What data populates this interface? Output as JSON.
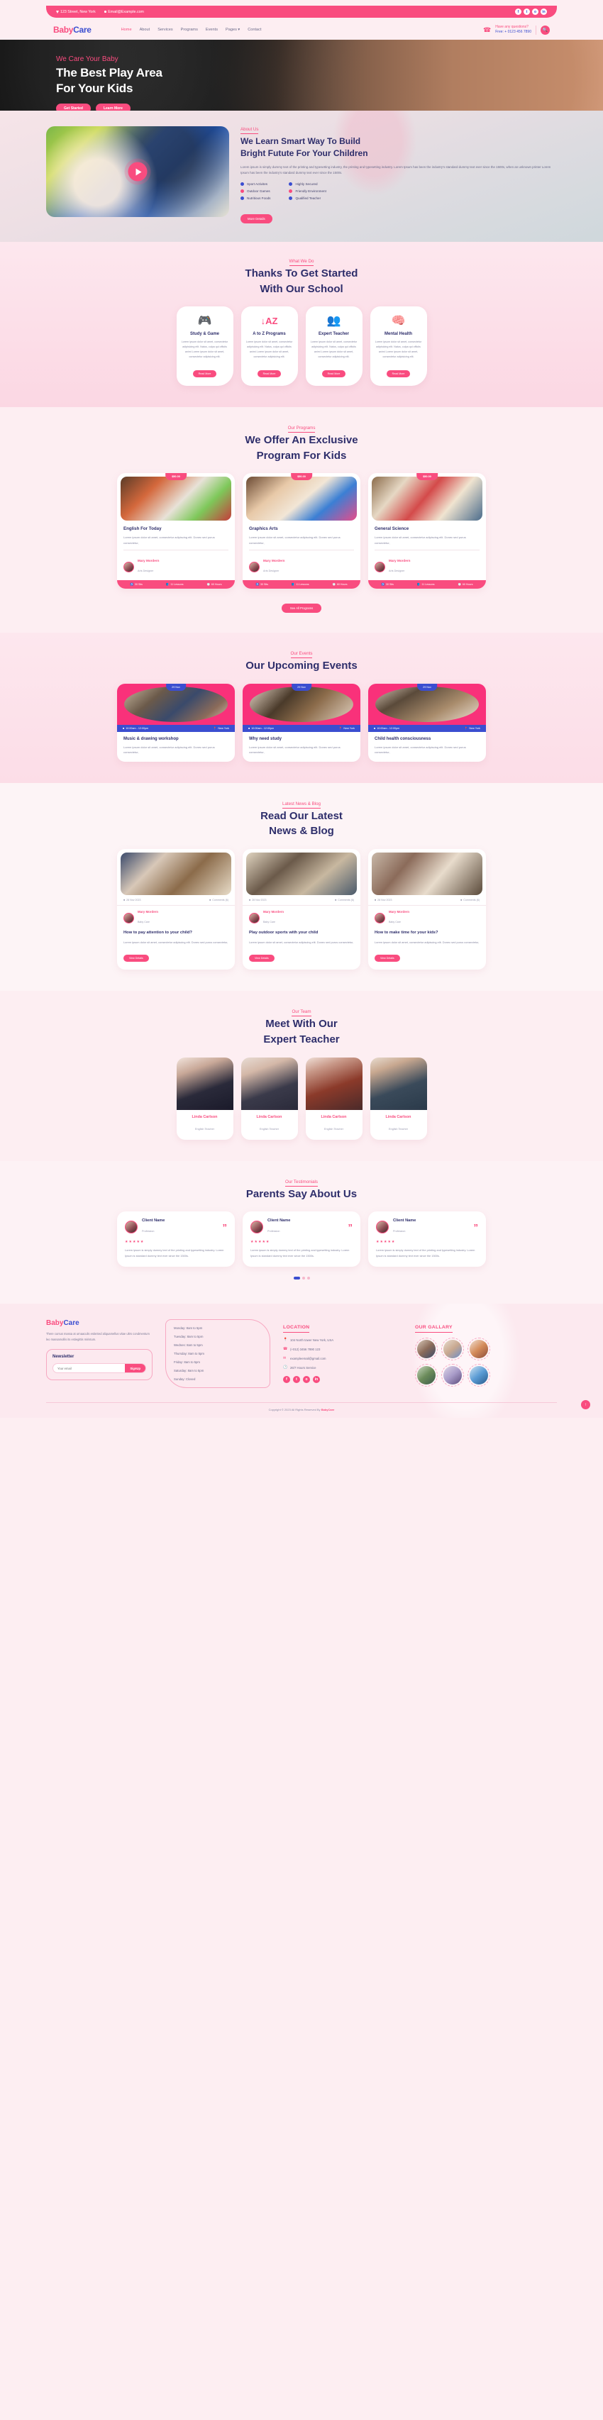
{
  "topbar": {
    "address": "123 Street, New York",
    "email": "Email@Example.com",
    "socials": [
      "f",
      "t",
      "o",
      "in"
    ]
  },
  "brand": {
    "part1": "Baby",
    "part2": "Care"
  },
  "nav": {
    "items": [
      {
        "label": "Home",
        "active": true
      },
      {
        "label": "About",
        "active": false
      },
      {
        "label": "Services",
        "active": false
      },
      {
        "label": "Programs",
        "active": false
      },
      {
        "label": "Events",
        "active": false
      },
      {
        "label": "Pages ▾",
        "active": false
      },
      {
        "label": "Contact",
        "active": false
      }
    ],
    "question_label": "Have any questions?",
    "phone": "Free: + 0123 456 7890",
    "search_icon": "search-icon"
  },
  "hero": {
    "kicker": "We Care Your Baby",
    "title_line1": "The Best Play Area",
    "title_line2": "For Your Kids",
    "btn_primary": "Get Started",
    "btn_secondary": "Learn More"
  },
  "about": {
    "label": "About Us",
    "title_line1": "We Learn Smart Way To Build",
    "title_line2": "Bright Futute For Your Children",
    "paragraph": "Lorem ipsum is simply dummy text of the printing and typesetting industry, the printing and typesetting industry. Lorem Ipsum has been the industry's standard dummy text ever since the 1500s, when an unknown printer Lorem Ipsum has been the industry's standard dummy text ever since the 1500s.",
    "list_left": [
      "Sport Activites",
      "Outdoor Games",
      "Nutritious Foods"
    ],
    "list_right": [
      "Highly Secured",
      "Friendly Environment",
      "Qualified Teacher"
    ],
    "button": "More Details",
    "play_icon": "play-icon"
  },
  "services": {
    "label": "What We Do",
    "title_line1": "Thanks To Get Started",
    "title_line2": "With Our School",
    "body": "Lorem ipsum dolor sit amet, consectetur adipisicing elit. Natus, culpa qui officiis animi Lorem ipsum dolor sit amet, consectetur adipisicing elit.",
    "button": "Read More",
    "cards": [
      {
        "icon": "gamepad-icon",
        "glyph": "🎮",
        "title": "Study & Game"
      },
      {
        "icon": "sort-az-icon",
        "glyph": "↓AzZ",
        "title": "A to Z Programs"
      },
      {
        "icon": "teacher-group-icon",
        "glyph": "👥",
        "title": "Expert Teacher"
      },
      {
        "icon": "mental-health-icon",
        "glyph": "🧠",
        "title": "Mental Health"
      }
    ]
  },
  "programs": {
    "label": "Our Programs",
    "title_line1": "We Offer An Exclusive",
    "title_line2": "Program For Kids",
    "all_button": "See All Programs",
    "body": "Lorem ipsum dolor sit amet, consectetur adipiscing elit. Donec sed purus consectetur,",
    "teacher_name": "Mary Mordern",
    "teacher_role": "Arts Designer",
    "price": "$50.00",
    "stats": [
      {
        "icon": "seat-icon",
        "glyph": "♿",
        "label": "30 Sits"
      },
      {
        "icon": "book-icon",
        "glyph": "📘",
        "label": "11 Lessons"
      },
      {
        "icon": "clock-icon",
        "glyph": "🕐",
        "label": "60 Hours"
      }
    ],
    "cards": [
      {
        "title": "English For Today"
      },
      {
        "title": "Graphics Arts"
      },
      {
        "title": "General Science"
      }
    ]
  },
  "events": {
    "label": "Our Events",
    "title": "Our Upcoming Events",
    "body": "Lorem ipsum dolor sit amet, consectetur adipiscing elit. Donec sed purus consectetur,",
    "date": "29 Nov",
    "time": "10:00am - 12:00pm",
    "location": "New York",
    "cards": [
      {
        "title": "Music & drawing workshop"
      },
      {
        "title": "Why need study"
      },
      {
        "title": "Child health consciousness"
      }
    ]
  },
  "blog": {
    "label": "Latest News & Blog",
    "title_line1": "Read Our Latest",
    "title_line2": "News & Blog",
    "body": "Lorem ipsum dolor sit amet, consectetur adipiscing elit. Donec sed purus consectetur,",
    "date": "28 Nov 2023",
    "comments": "Comments (6)",
    "author_name": "Mary Mordern",
    "author_role": "Baby Care",
    "button": "View Details",
    "cards": [
      {
        "title": "How to pay attention to your child?"
      },
      {
        "title": "Play outdoor sports with your child"
      },
      {
        "title": "How to make time for your kids?"
      }
    ]
  },
  "team": {
    "label": "Our Team",
    "title_line1": "Meet With Our",
    "title_line2": "Expert Teacher",
    "members": [
      {
        "name": "Linda Carlson",
        "role": "English Teacher"
      },
      {
        "name": "Linda Carlson",
        "role": "English Teacher"
      },
      {
        "name": "Linda Carlson",
        "role": "English Teacher"
      },
      {
        "name": "Linda Carlson",
        "role": "English Teacher"
      }
    ]
  },
  "testimonials": {
    "label": "Our Testimonials",
    "title": "Parents Say About Us",
    "stars": "★★★★★",
    "quote_mark": "”",
    "body": "Lorem ipsum is simply dummy text of the printing and typesetting industry. Lorem Ipsum is standard dummy text ever since the 1500s.",
    "cards": [
      {
        "name": "Client Name",
        "role": "Profession"
      },
      {
        "name": "Client Name",
        "role": "Profession"
      },
      {
        "name": "Client Name",
        "role": "Profession"
      }
    ],
    "dots": [
      true,
      false,
      false
    ]
  },
  "footer": {
    "about_text": "There cursus massa at urnaaculis estieSed aliquamellus vitae ultrs condmentum leo massamollis its estiegittis miristum.",
    "newsletter_title": "Newsletter",
    "newsletter_placeholder": "Your email",
    "newsletter_button": "SignUp",
    "hours": [
      "Monday: 8am to 5pm",
      "Tuesday: 8am to 5pm",
      "Wednes: 8am to 5pm",
      "Thursday: 8am to 5pm",
      "Friday: 8am to 5pm",
      "Saturday: 8am to 5pm",
      "Sunday: Closed"
    ],
    "location_title": "LOCATION",
    "location_items": [
      {
        "icon": "map-pin-icon",
        "glyph": "📍",
        "text": "104 North tower New York, USA"
      },
      {
        "icon": "phone-icon",
        "glyph": "☎",
        "text": "(+012) 3456 7890 123"
      },
      {
        "icon": "envelope-icon",
        "glyph": "✉",
        "text": "exampleemail@gmail.com"
      },
      {
        "icon": "clock-icon",
        "glyph": "🕐",
        "text": "26/7 Hours Service"
      }
    ],
    "socials": [
      "f",
      "t",
      "o",
      "in"
    ],
    "gallery_title": "OUR GALLARY",
    "copyright_pre": "Copyright © 2023 All Rights Reserved By ",
    "copyright_brand": "BabyCare",
    "totop_icon": "arrow-up-icon"
  }
}
